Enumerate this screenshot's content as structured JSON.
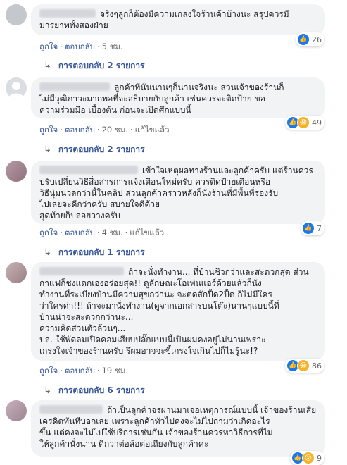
{
  "comments": [
    {
      "lines": [
        "จริงๆลูกก็ต้องมีความเกลงใจร้านค้าบ้างนะ สรุปควรมี",
        "มารยาททั้งสองฝ่าย"
      ],
      "reaction_count": "26",
      "like": "ถูกใจ",
      "reply": "ตอบกลับ",
      "time": "5 ชม.",
      "edited": "",
      "replies": "การตอบกลับ 2 รายการ"
    },
    {
      "lines": [
        "ลูกค้าที่นั่นนานๆก็นานจริงนะ ส่วนเจ้าของร้านก็",
        "ไม่มีวุฒิภาวะมากพอที่จะอธิบายกับลูกค้า เช่นควรจะติดป้าย ขอ",
        "ความร่วมมือ เบื้องต้น ก่อนจะเปิดศึกแบบนี้"
      ],
      "reaction_count": "49",
      "like": "ถูกใจ",
      "reply": "ตอบกลับ",
      "time": "20 ชม.",
      "edited": "แก้ไขแล้ว",
      "replies": "การตอบกลับ 2 รายการ"
    },
    {
      "lines": [
        "เข้าใจเหตุผลทางร้านและลูกค้าครับ แต่ร้านควร",
        "ปรับเปลี่ยนวิธีสื่อสารการแจ้งเตือนใหม่ครับ ควรติดป้ายเตือนหรือ",
        "วิธีนุ่มนวลกว่านี้ในคลิป ส่วนลูกค้าคราวหลังก็นั่งร้านที่มีพื้นที่รองรับ",
        "ไปเลยจะดีกว่าครับ สบายใจดีด้วย",
        "สุดท้ายก็ปล่อยวางครับ"
      ],
      "reaction_count": "7",
      "like": "ถูกใจ",
      "reply": "ตอบกลับ",
      "time": "4 ชม.",
      "edited": "แก้ไขแล้ว",
      "replies": "การตอบกลับ 1 รายการ"
    },
    {
      "lines": [
        "ถ้าจะนั่งทำงาน... ที่บ้านชิวกว่าและสะดวกสุด ส่วน",
        "กาแฟก็ชงแดกเองอร่อยสุด!! ดูลักษณะโอเพ่นแอร์ด้วยแล้วก็นั่ง",
        "ทำงานที่ระเบียงบ้านมีความสุขกว่านะ จะตดสักปื้ด2ปื้ด ก็ไม่มีใคร",
        "ว่าใครด่า!!! ถ้าจะมานั่งทำงาน(ดูจากเอกสารบนโต๊ะ)นานๆแบบนี้ที่",
        "บ้านน่าจะสะดวกกว่านะ...",
        "ความคิดส่วนตัวล้วนๆ...",
        "ปล. ใช้พัดลมเปิดคอมเสียบปลั๊กแบบนี้เป็นผมคงอยู่ไม่นานเพราะ",
        "เกรงใจเจ้าของร้านครับ รึผมอาจจะขี้เกรงใจเกินไปก็ไม่รู้นะ!?"
      ],
      "reaction_count": "86",
      "like": "ถูกใจ",
      "reply": "ตอบกลับ",
      "time": "19 ชม.",
      "edited": "",
      "replies": "การตอบกลับ 6 รายการ"
    },
    {
      "lines": [
        "ถ้าเป็นลูกค้าจรผ่านมาเจอเหตุการณ์แบบนี้ เจ้าของร้านเสีย",
        "เครดิตทันทีบอกเลย เพราะลูกค้าทั่วไปคงจะไม่ไปถามว่าเกิดอะไร",
        "ขึ้น แต่คงจะไม่ไปใช้บริการเช่นกัน เจ้าของร้านควรหาวิธีการที่ไม่",
        "ให้ลูกค้านั่งนาน ดีกว่าต่อล้อต่อเถียงกับลูกค้าค่ะ"
      ],
      "reaction_count": "9",
      "like": "",
      "reply": "",
      "time": "",
      "edited": "",
      "replies": ""
    }
  ]
}
